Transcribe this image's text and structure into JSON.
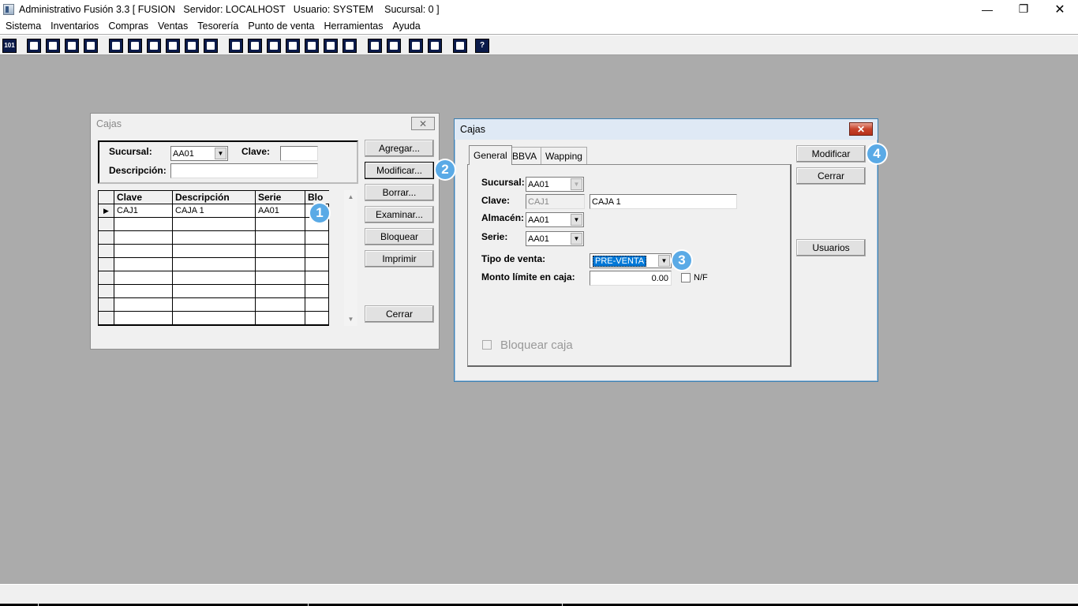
{
  "app": {
    "title": "Administrativo Fusión 3.3 [ FUSION   Servidor: LOCALHOST   Usuario: SYSTEM    Sucursal: 0 ]",
    "win_min": "—",
    "win_max": "❐",
    "win_close": "✕"
  },
  "menu": [
    "Sistema",
    "Inventarios",
    "Compras",
    "Ventas",
    "Tesorería",
    "Punto de venta",
    "Herramientas",
    "Ayuda"
  ],
  "toolbar_icons": [
    "calculator-icon",
    "copy-icon",
    "clipboard-icon",
    "transfer-icon",
    "find-icon",
    "user-icon",
    "folder-icon",
    "import-icon",
    "print-icon",
    "document-icon",
    "list-icon",
    "people-icon",
    "box-icon",
    "export-icon",
    "add-icon",
    "money-icon",
    "report-icon",
    "table-icon",
    "home-icon",
    "zoom-icon",
    "refresh-icon",
    "undo-icon",
    "back-icon",
    "help-icon"
  ],
  "toolbar_help_glyph": "?",
  "toolbar_calc_glyph": "101",
  "list_window": {
    "title": "Cajas",
    "close": "✕",
    "filter": {
      "sucursal_label": "Sucursal:",
      "sucursal_value": "AA01",
      "clave_label": "Clave:",
      "clave_value": "",
      "descripcion_label": "Descripción:",
      "descripcion_value": ""
    },
    "columns": [
      "Clave",
      "Descripción",
      "Serie",
      "Blo"
    ],
    "rows": [
      {
        "indicator": "▶",
        "clave": "CAJ1",
        "descripcion": "CAJA 1",
        "serie": "AA01",
        "blo": ""
      }
    ],
    "buttons": {
      "agregar": "Agregar...",
      "modificar": "Modificar...",
      "borrar": "Borrar...",
      "examinar": "Examinar...",
      "bloquear": "Bloquear",
      "imprimir": "Imprimir",
      "cerrar": "Cerrar"
    }
  },
  "edit_window": {
    "title": "Cajas",
    "close": "✕",
    "tabs": [
      "General",
      "BBVA",
      "Wapping"
    ],
    "fields": {
      "sucursal_label": "Sucursal:",
      "sucursal_value": "AA01",
      "clave_label": "Clave:",
      "clave_value": "CAJ1",
      "clave_desc": "CAJA 1",
      "almacen_label": "Almacén:",
      "almacen_value": "AA01",
      "serie_label": "Serie:",
      "serie_value": "AA01",
      "tipo_venta_label": "Tipo de venta:",
      "tipo_venta_value": "PRE-VENTA",
      "monto_label": "Monto límite en caja:",
      "monto_value": "0.00",
      "nf_label": "N/F",
      "bloquear_label": "Bloquear caja"
    },
    "buttons": {
      "modificar": "Modificar",
      "cerrar": "Cerrar",
      "usuarios": "Usuarios"
    }
  },
  "badges": [
    "1",
    "2",
    "3",
    "4"
  ],
  "dropdown_glyph": "▼",
  "scroll_up": "▲",
  "scroll_down": "▼"
}
